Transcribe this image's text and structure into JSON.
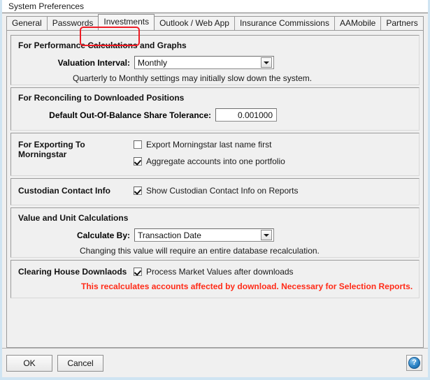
{
  "window": {
    "title": "System Preferences"
  },
  "tabs": [
    {
      "label": "General",
      "active": false
    },
    {
      "label": "Passwords",
      "active": false
    },
    {
      "label": "Investments",
      "active": true
    },
    {
      "label": "Outlook / Web App",
      "active": false
    },
    {
      "label": "Insurance Commissions",
      "active": false
    },
    {
      "label": "AAMobile",
      "active": false
    },
    {
      "label": "Partners",
      "active": false
    }
  ],
  "annotation": {
    "color": "#ee1c25",
    "target_tab": "Investments"
  },
  "groups": {
    "performance": {
      "title": "For Performance Calculations and Graphs",
      "field_label": "Valuation Interval:",
      "field_value": "Monthly",
      "note": "Quarterly to Monthly settings may initially slow down the system."
    },
    "reconciling": {
      "title": "For Reconciling to Downloaded Positions",
      "field_label": "Default Out-Of-Balance Share Tolerance:",
      "field_value": "0.001000"
    },
    "morningstar": {
      "title": "For Exporting To Morningstar",
      "checkboxes": [
        {
          "label": "Export Morningstar last name first",
          "checked": false
        },
        {
          "label": "Aggregate accounts into one portfolio",
          "checked": true
        }
      ]
    },
    "custodian": {
      "title": "Custodian Contact Info",
      "checkbox": {
        "label": "Show Custodian Contact Info on Reports",
        "checked": true
      }
    },
    "valueunit": {
      "title": "Value and Unit Calculations",
      "field_label": "Calculate By:",
      "field_value": "Transaction Date",
      "note": "Changing this value will require an entire database recalculation."
    },
    "clearinghouse": {
      "title": "Clearing House Downlaods",
      "checkbox": {
        "label": "Process Market Values after downloads",
        "checked": true
      },
      "warning": "This recalculates accounts affected by download.   Necessary for  Selection Reports.",
      "warning_color": "#ff2b18"
    }
  },
  "buttons": {
    "ok": "OK",
    "cancel": "Cancel",
    "help": "?"
  }
}
